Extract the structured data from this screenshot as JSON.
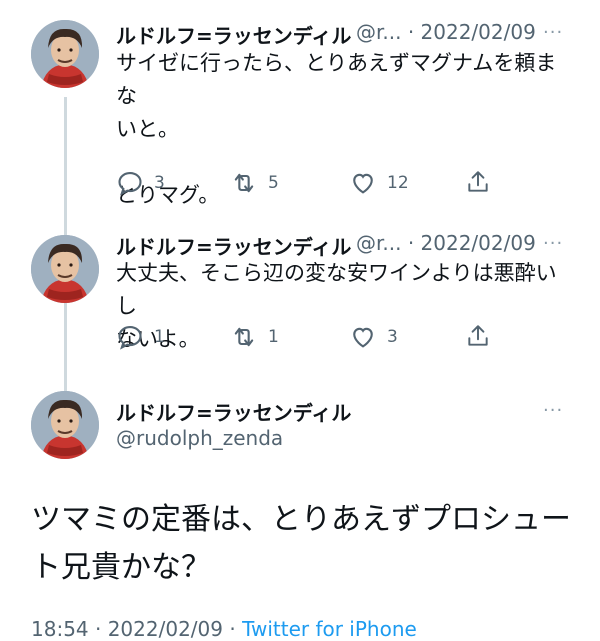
{
  "tweets": [
    {
      "name": "ルドルフ=ラッセンディル",
      "handle_date": "@r... · 2022/02/09",
      "text_line1": "サイゼに行ったら、とりあえずマグナムを頼まな",
      "text_line2": "いと。",
      "text_line3": "とりマグ。",
      "replies": "3",
      "retweets": "5",
      "likes": "12"
    },
    {
      "name": "ルドルフ=ラッセンディル",
      "handle_date": "@r... · 2022/02/09",
      "text_line1": "大丈夫、そこら辺の変な安ワインよりは悪酔いし",
      "text_line2": "ないよ。",
      "replies": "1",
      "retweets": "1",
      "likes": "3"
    }
  ],
  "main_tweet": {
    "name": "ルドルフ=ラッセンディル",
    "handle": "@rudolph_zenda",
    "text_line1": "ツマミの定番は、とりあえずプロシュー",
    "text_line2": "ト兄貴かな？",
    "time_date": "18:54 · 2022/02/09 · ",
    "source": "Twitter for iPhone"
  },
  "more_glyph": "···",
  "icons": [
    "reply-icon",
    "retweet-icon",
    "like-icon",
    "share-icon",
    "more-icon",
    "avatar"
  ],
  "colors": {
    "text": "#0f1419",
    "secondary": "#536471",
    "link": "#1d9bf0",
    "line": "#cfd9de"
  }
}
